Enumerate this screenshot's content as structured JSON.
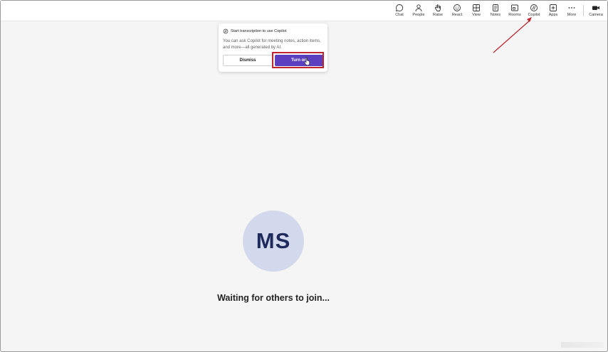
{
  "toolbar": {
    "items": [
      {
        "label": "Chat",
        "icon": "chat-icon"
      },
      {
        "label": "People",
        "icon": "people-icon"
      },
      {
        "label": "Raise",
        "icon": "raise-hand-icon"
      },
      {
        "label": "React",
        "icon": "react-icon"
      },
      {
        "label": "View",
        "icon": "view-icon"
      },
      {
        "label": "Notes",
        "icon": "notes-icon"
      },
      {
        "label": "Rooms",
        "icon": "rooms-icon"
      },
      {
        "label": "Copilot",
        "icon": "copilot-icon"
      },
      {
        "label": "Apps",
        "icon": "apps-icon"
      },
      {
        "label": "More",
        "icon": "more-icon"
      },
      {
        "label": "Camera",
        "icon": "camera-icon"
      }
    ]
  },
  "popup": {
    "title": "Start transcription to use Copilot",
    "description": "You can ask Copilot for meeting notes, action items, and more—all generated by AI.",
    "dismiss_label": "Dismiss",
    "turn_on_label": "Turn on"
  },
  "stage": {
    "avatar_initials": "MS",
    "status_text": "Waiting for others to join..."
  },
  "colors": {
    "accent": "#5b3fbf",
    "highlight": "#c0242d",
    "avatar_bg": "#d3d9ec",
    "avatar_text": "#1f2a5c"
  }
}
